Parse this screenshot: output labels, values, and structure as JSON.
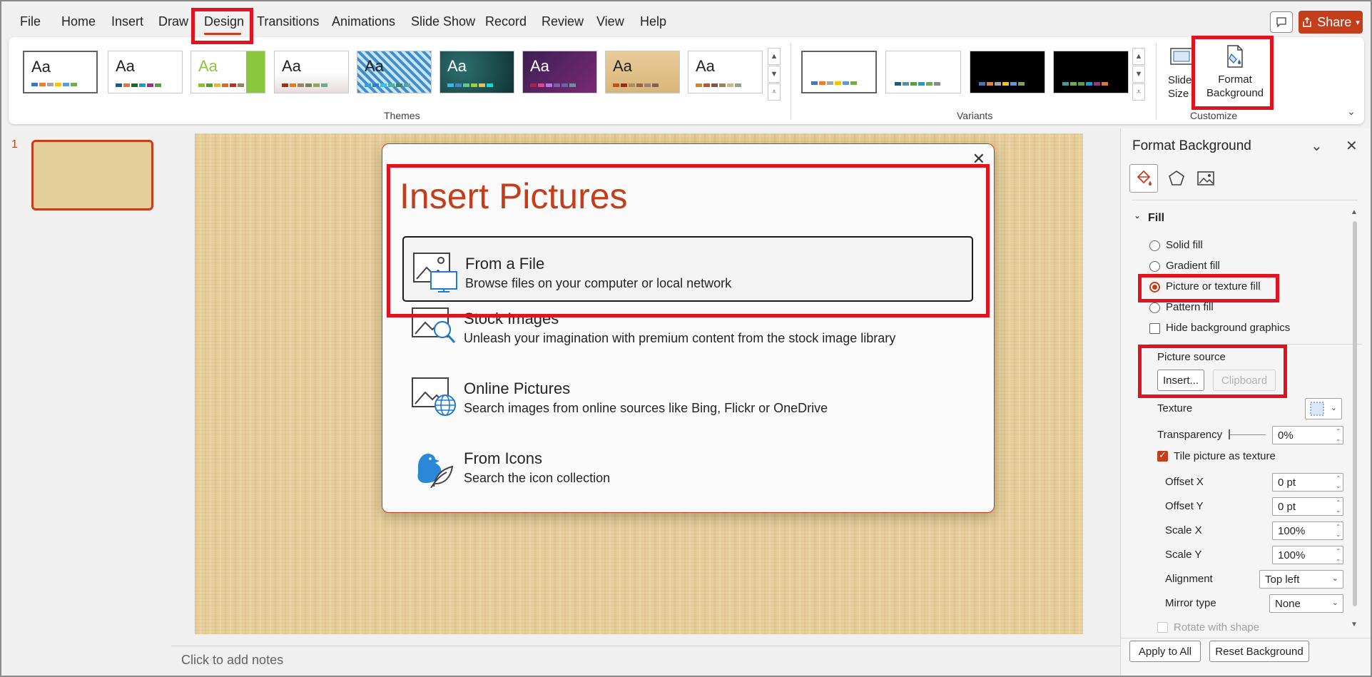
{
  "menu": {
    "tabs": [
      "File",
      "Home",
      "Insert",
      "Draw",
      "Design",
      "Transitions",
      "Animations",
      "Slide Show",
      "Record",
      "Review",
      "View",
      "Help"
    ],
    "active_tab": "Design",
    "share_label": "Share"
  },
  "ribbon": {
    "themes_label": "Themes",
    "variants_label": "Variants",
    "customize_label": "Customize",
    "theme_sample_text": "Aa",
    "slide_size_label_line1": "Slide",
    "slide_size_label_line2": "Size",
    "format_background_line1": "Format",
    "format_background_line2": "Background"
  },
  "thumbnail": {
    "slide_number": "1"
  },
  "notes": {
    "placeholder": "Click to add notes"
  },
  "dialog": {
    "title": "Insert Pictures",
    "close_glyph": "✕",
    "options": [
      {
        "title": "From a File",
        "desc": "Browse files on your computer or local network"
      },
      {
        "title": "Stock Images",
        "desc": "Unleash your imagination with premium content from the stock image library"
      },
      {
        "title": "Online Pictures",
        "desc": "Search images from online sources like Bing, Flickr or OneDrive"
      },
      {
        "title": "From Icons",
        "desc": "Search the icon collection"
      }
    ]
  },
  "format_pane": {
    "title": "Format Background",
    "section": "Fill",
    "fill_options": [
      "Solid fill",
      "Gradient fill",
      "Picture or texture fill",
      "Pattern fill"
    ],
    "selected_fill": "Picture or texture fill",
    "hide_bg_label": "Hide background graphics",
    "picture_source_label": "Picture source",
    "insert_btn": "Insert...",
    "clipboard_btn": "Clipboard",
    "texture_label": "Texture",
    "transparency_label": "Transparency",
    "transparency_value": "0%",
    "tile_label": "Tile picture as texture",
    "offset_x_label": "Offset X",
    "offset_x_value": "0 pt",
    "offset_y_label": "Offset Y",
    "offset_y_value": "0 pt",
    "scale_x_label": "Scale X",
    "scale_x_value": "100%",
    "scale_y_label": "Scale Y",
    "scale_y_value": "100%",
    "alignment_label": "Alignment",
    "alignment_value": "Top left",
    "mirror_label": "Mirror type",
    "mirror_value": "None",
    "rotate_label": "Rotate with shape",
    "apply_all_btn": "Apply to All",
    "reset_btn": "Reset Background"
  },
  "colors": {
    "accent": "#c43e1c",
    "highlight_box": "#e0141e"
  }
}
